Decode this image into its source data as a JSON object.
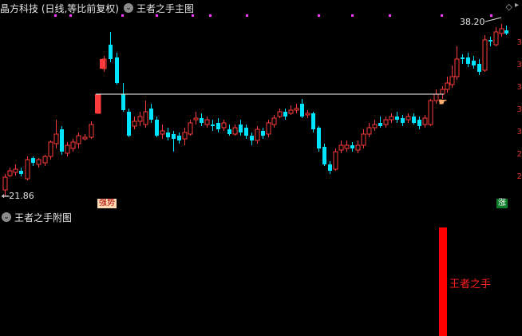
{
  "header": {
    "stock_title": "晶方科技 (日线,等比前复权)",
    "main_indicator": "王者之手主图",
    "sub_indicator": "王者之手附图"
  },
  "labels": {
    "high_price": "38.20",
    "low_price": "21.86",
    "signal_left": "强势",
    "signal_right": "涨",
    "sub_label": "王者之手"
  },
  "colors": {
    "up": "#ff3b3b",
    "down": "#00e5ff",
    "hline": "#ffffff",
    "dots": "#ff33ff",
    "signal_bar": "#ff0000"
  },
  "icons": {
    "dropdown": "chevron-down-icon",
    "corner": "diamond-icon",
    "cursor": "hand-pointer-icon"
  }
}
